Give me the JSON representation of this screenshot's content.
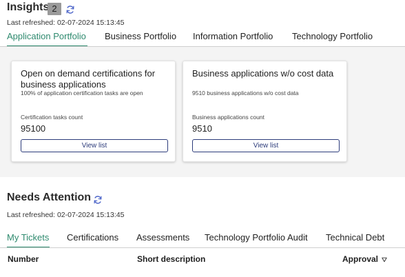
{
  "insights": {
    "title": "Insights",
    "count": "2",
    "last_refreshed": "Last refreshed: 02-07-2024 15:13:45",
    "tabs": [
      {
        "label": "Application Portfolio",
        "active": true
      },
      {
        "label": "Business Portfolio",
        "active": false
      },
      {
        "label": "Information Portfolio",
        "active": false
      },
      {
        "label": "Technology Portfolio",
        "active": false
      }
    ],
    "cards": [
      {
        "title": "Open on demand certifications for business applications",
        "subtitle": "100% of application certification tasks are open",
        "metric_label": "Certification tasks count",
        "metric_value": "95100",
        "button_label": "View list"
      },
      {
        "title": "Business applications w/o cost data",
        "subtitle": "9510 business applications w/o cost data",
        "metric_label": "Business applications count",
        "metric_value": "9510",
        "button_label": "View list"
      }
    ]
  },
  "attention": {
    "title": "Needs Attention",
    "last_refreshed": "Last refreshed: 02-07-2024 15:13:45",
    "tabs": [
      {
        "label": "My Tickets",
        "active": true
      },
      {
        "label": "Certifications",
        "active": false
      },
      {
        "label": "Assessments",
        "active": false
      },
      {
        "label": "Technology Portfolio Audit",
        "active": false
      },
      {
        "label": "Technical Debt",
        "active": false
      }
    ],
    "table": {
      "columns": [
        "Number",
        "Short description",
        "Approval"
      ]
    }
  },
  "colors": {
    "accent": "#2e8a6e",
    "button": "#2c3b7a",
    "panel_bg": "#f4f4f4"
  }
}
